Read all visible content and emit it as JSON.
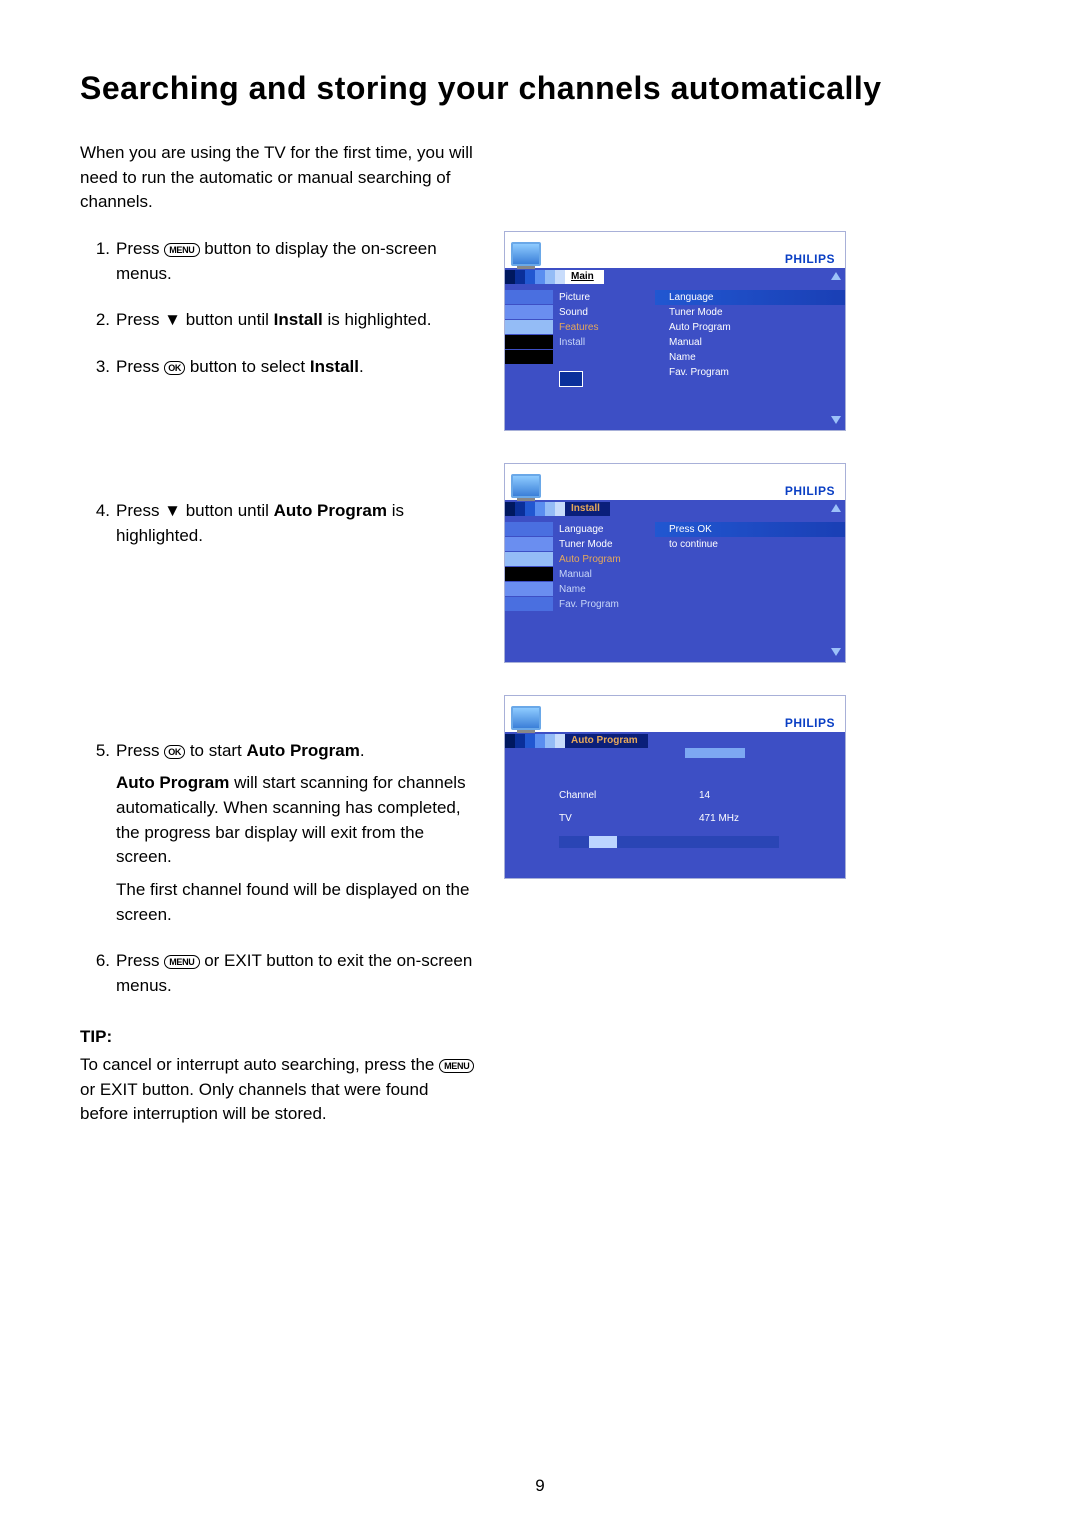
{
  "title": "Searching and storing your channels automatically",
  "intro": "When you are using the TV for the first time, you will need to run the automatic or manual searching of channels.",
  "buttons": {
    "menu": "MENU",
    "ok": "OK"
  },
  "steps": {
    "s1a": "Press ",
    "s1b": " button to display the on-screen menus.",
    "s2a": "Press ▼ button until ",
    "s2b": "Install",
    "s2c": " is highlighted.",
    "s3a": "Press ",
    "s3b": " button to select ",
    "s3c": "Install",
    "s3d": ".",
    "s4a": "Press ▼ button until ",
    "s4b": "Auto Program",
    "s4c": " is highlighted.",
    "s5a": "Press ",
    "s5b": " to start ",
    "s5c": "Auto Program",
    "s5d": ".",
    "s5p1a": "Auto Program",
    "s5p1b": " will start scanning for channels automatically. When scanning has completed, the progress bar display will exit from the screen.",
    "s5p2": "The first channel found will be displayed on the screen.",
    "s6a": "Press ",
    "s6b": " or EXIT button to exit the on-screen menus."
  },
  "tip_label": "TIP:",
  "tip_body_a": "To cancel or interrupt auto searching, press the ",
  "tip_body_b": " or EXIT button. Only channels that were found before interruption will be stored.",
  "brand": "PHILIPS",
  "screen1": {
    "breadcrumb": "Main",
    "left": [
      "Picture",
      "Sound",
      "Features",
      "Install"
    ],
    "right": [
      "Language",
      "Tuner Mode",
      "Auto Program",
      "Manual",
      "Name",
      "Fav. Program"
    ]
  },
  "screen2": {
    "breadcrumb": "Install",
    "left": [
      "Language",
      "Tuner Mode",
      "Auto Program",
      "Manual",
      "Name",
      "Fav. Program"
    ],
    "right1": "Press OK",
    "right2": "to continue"
  },
  "screen3": {
    "breadcrumb": "Auto Program",
    "channel_k": "Channel",
    "channel_v": "14",
    "tv_k": "TV",
    "tv_v": "471 MHz"
  },
  "page_num": "9"
}
